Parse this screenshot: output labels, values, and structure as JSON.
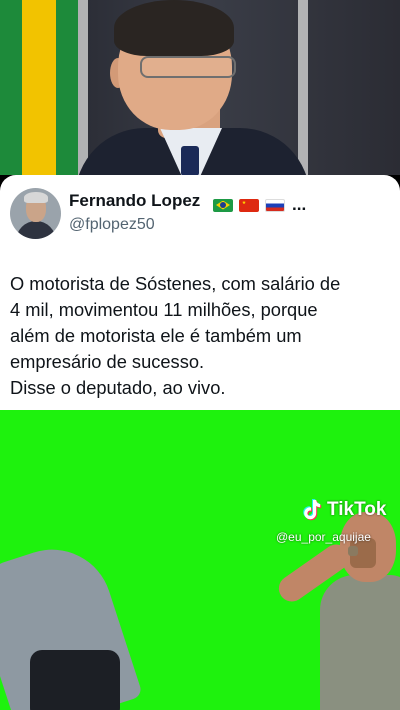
{
  "tweet": {
    "author_name": "Fernando Lopez",
    "name_flags": [
      "brazil-flag",
      "china-flag",
      "russia-flag"
    ],
    "name_overflow": "...",
    "handle": "@fplopez50",
    "lines": [
      "O motorista de Sóstenes,  com salário de",
      "4 mil, movimentou 11 milhões,  porque",
      "além de motorista ele é também um",
      "empresário de sucesso.",
      "Disse o deputado, ao vivo."
    ]
  },
  "watermark": {
    "brand": "TikTok",
    "username": "@eu_por_aquijae"
  },
  "colors": {
    "green_screen": "#1ef20d",
    "card_background": "#ffffff",
    "handle_gray": "#536471"
  }
}
